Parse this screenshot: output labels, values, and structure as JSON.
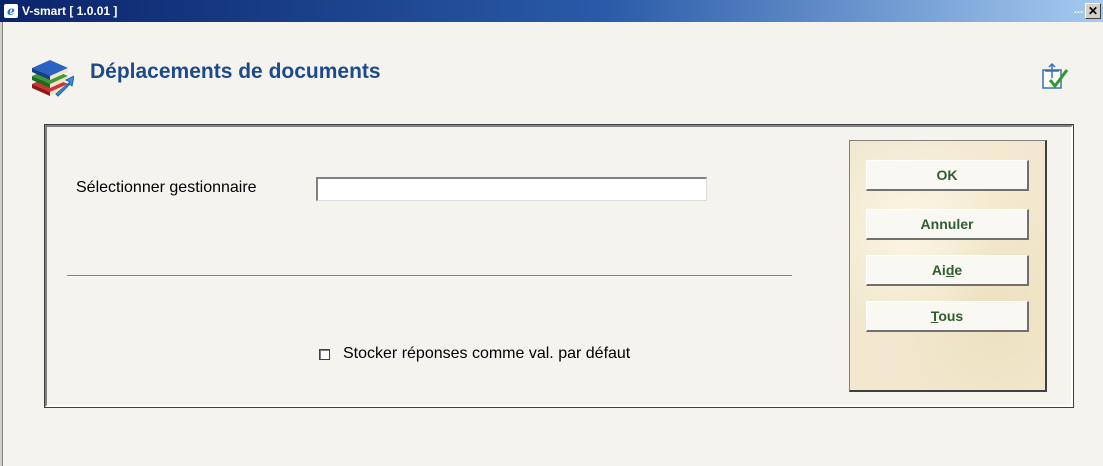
{
  "window": {
    "title": "V-smart [ 1.0.01 ]",
    "app_icon": "ie-e-icon",
    "close_label": "✕",
    "overflow_label": "..."
  },
  "header": {
    "title": "Déplacements de documents",
    "icon": "books-icon",
    "tool_icon": "select-check-icon"
  },
  "form": {
    "manager_label": "Sélectionner gestionnaire",
    "manager_value": "",
    "store_defaults_label": "Stocker réponses comme val. par défaut",
    "store_defaults_checked": false
  },
  "buttons": {
    "ok": "OK",
    "cancel": "Annuler",
    "help_pre": "Ai",
    "help_mnemonic": "d",
    "help_post": "e",
    "all_mnemonic": "T",
    "all_post": "ous"
  },
  "colors": {
    "title_bar": "#0a246a",
    "page_title": "#1f4a8a",
    "button_text": "#2f5d2f",
    "button_panel": "#f1e8cf"
  }
}
